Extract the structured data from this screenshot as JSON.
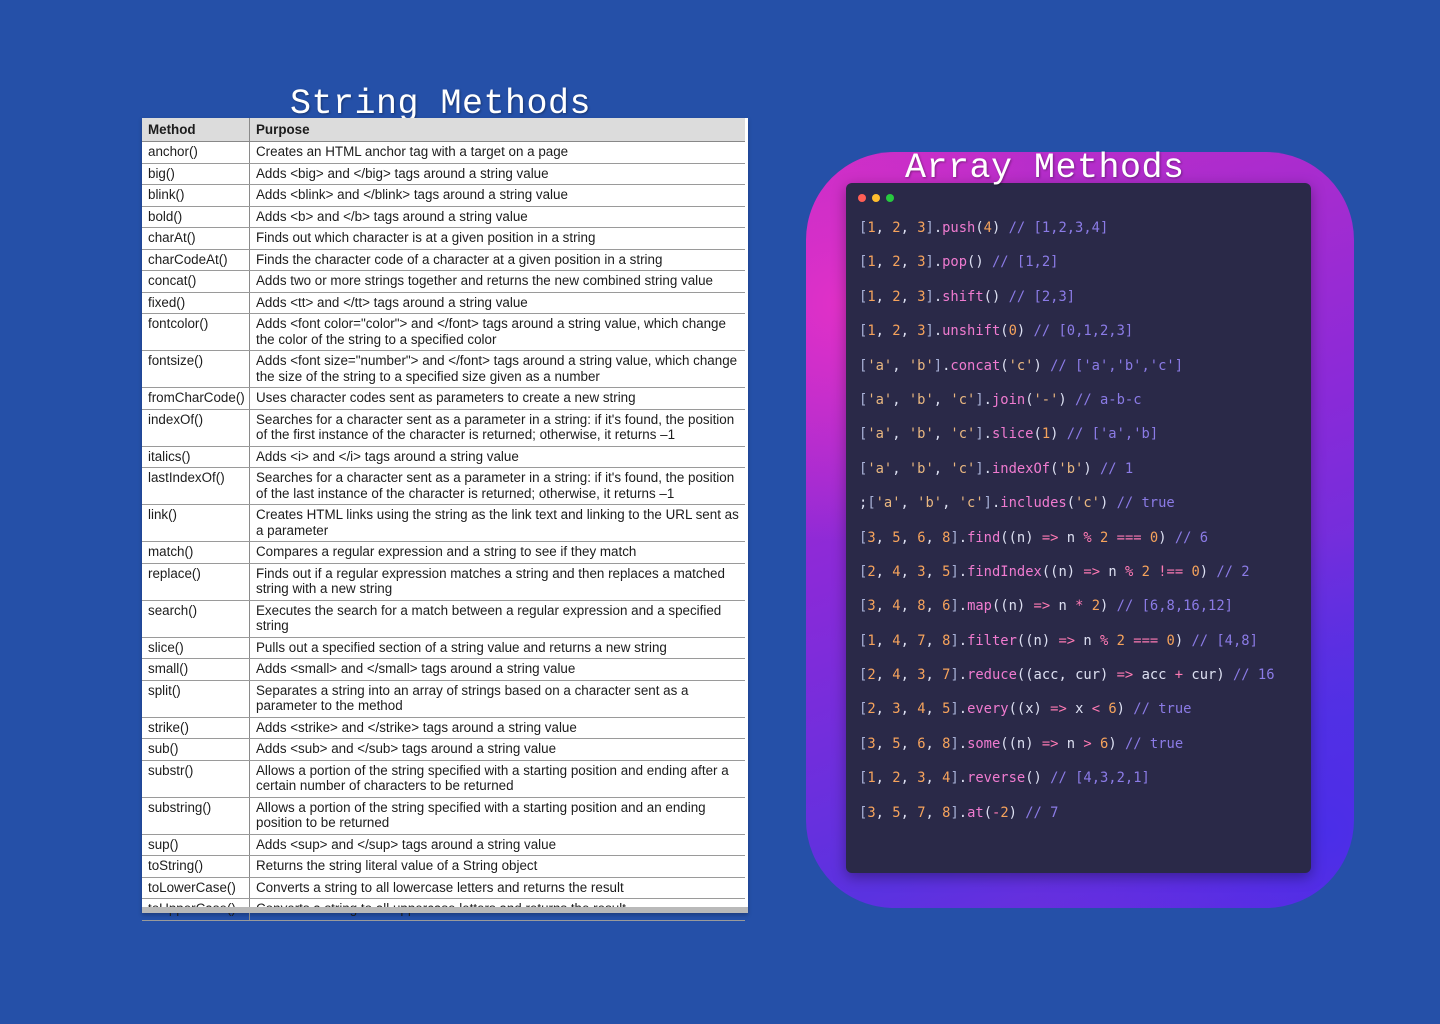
{
  "string_section": {
    "title": "String Methods",
    "header": {
      "method": "Method",
      "purpose": "Purpose"
    },
    "rows": [
      {
        "method": "anchor()",
        "purpose": "Creates an HTML anchor tag with a target on a page"
      },
      {
        "method": "big()",
        "purpose": "Adds <big> and </big> tags around a string value"
      },
      {
        "method": "blink()",
        "purpose": "Adds <blink> and </blink> tags around a string value"
      },
      {
        "method": "bold()",
        "purpose": "Adds <b> and </b> tags around a string value"
      },
      {
        "method": "charAt()",
        "purpose": "Finds out which character is at a given position in a string"
      },
      {
        "method": "charCodeAt()",
        "purpose": "Finds the character code of a character at a given position in a string"
      },
      {
        "method": "concat()",
        "purpose": "Adds two or more strings together and returns the new combined string value"
      },
      {
        "method": "fixed()",
        "purpose": "Adds <tt> and </tt> tags around a string value"
      },
      {
        "method": "fontcolor()",
        "purpose": "Adds <font color=\"color\"> and </font> tags around a string value, which change the color of the string to a specified color"
      },
      {
        "method": "fontsize()",
        "purpose": "Adds <font size=\"number\"> and </font> tags around a string value, which change the size of the string to a specified size given as a number"
      },
      {
        "method": "fromCharCode()",
        "purpose": "Uses character codes sent as parameters to create a new string"
      },
      {
        "method": "indexOf()",
        "purpose": "Searches for a character sent as a parameter in a string: if it's found, the position of the first instance of the character is returned; otherwise, it returns –1"
      },
      {
        "method": "italics()",
        "purpose": "Adds <i> and </i> tags around a string value"
      },
      {
        "method": "lastIndexOf()",
        "purpose": "Searches for a character sent as a parameter in a string: if it's found, the position of the last instance of the character is returned; otherwise, it returns –1"
      },
      {
        "method": "link()",
        "purpose": "Creates HTML links using the string as the link text and linking to the URL sent as a parameter"
      },
      {
        "method": "match()",
        "purpose": "Compares a regular expression and a string to see if they match"
      },
      {
        "method": "replace()",
        "purpose": "Finds out if a regular expression matches a string and then replaces a matched string with a new string"
      },
      {
        "method": "search()",
        "purpose": "Executes the search for a match between a regular expression and a specified string"
      },
      {
        "method": "slice()",
        "purpose": "Pulls out a specified section of a string value and returns a new string"
      },
      {
        "method": "small()",
        "purpose": "Adds <small> and </small> tags around a string value"
      },
      {
        "method": "split()",
        "purpose": "Separates a string into an array of strings based on a character sent as a parameter to the method"
      },
      {
        "method": "strike()",
        "purpose": "Adds <strike> and </strike> tags around a string value"
      },
      {
        "method": "sub()",
        "purpose": "Adds <sub> and </sub> tags around a string value"
      },
      {
        "method": "substr()",
        "purpose": "Allows a portion of the string specified with a starting position and ending after a certain number of characters to be returned"
      },
      {
        "method": "substring()",
        "purpose": "Allows a portion of the string specified with a starting position and an ending position to be returned"
      },
      {
        "method": "sup()",
        "purpose": "Adds <sup> and </sup> tags around a string value"
      },
      {
        "method": "toString()",
        "purpose": "Returns the string literal value of a String object"
      },
      {
        "method": "toLowerCase()",
        "purpose": "Converts a string to all lowercase letters and returns the result"
      },
      {
        "method": "toUpperCase()",
        "purpose": "Converts a string to all uppercase letters and returns the result"
      }
    ]
  },
  "array_section": {
    "title": "Array Methods",
    "window_dots": [
      "#ff5f56",
      "#ffbd2e",
      "#27c93f"
    ],
    "lines": [
      "[1, 2, 3].push(4) // [1,2,3,4]",
      "[1, 2, 3].pop() // [1,2]",
      "[1, 2, 3].shift() // [2,3]",
      "[1, 2, 3].unshift(0) // [0,1,2,3]",
      "['a', 'b'].concat('c') // ['a','b','c']",
      "['a', 'b', 'c'].join('-') // a-b-c",
      "['a', 'b', 'c'].slice(1) // ['a','b]",
      "['a', 'b', 'c'].indexOf('b') // 1",
      ";['a', 'b', 'c'].includes('c') // true",
      "[3, 5, 6, 8].find((n) => n % 2 === 0) // 6",
      "[2, 4, 3, 5].findIndex((n) => n % 2 !== 0) // 2",
      "[3, 4, 8, 6].map((n) => n * 2) // [6,8,16,12]",
      "[1, 4, 7, 8].filter((n) => n % 2 === 0) // [4,8]",
      "[2, 4, 3, 7].reduce((acc, cur) => acc + cur) // 16",
      "[2, 3, 4, 5].every((x) => x < 6) // true",
      "[3, 5, 6, 8].some((n) => n > 6) // true",
      "[1, 2, 3, 4].reverse() // [4,3,2,1]",
      "[3, 5, 7, 8].at(-2) // 7"
    ]
  }
}
